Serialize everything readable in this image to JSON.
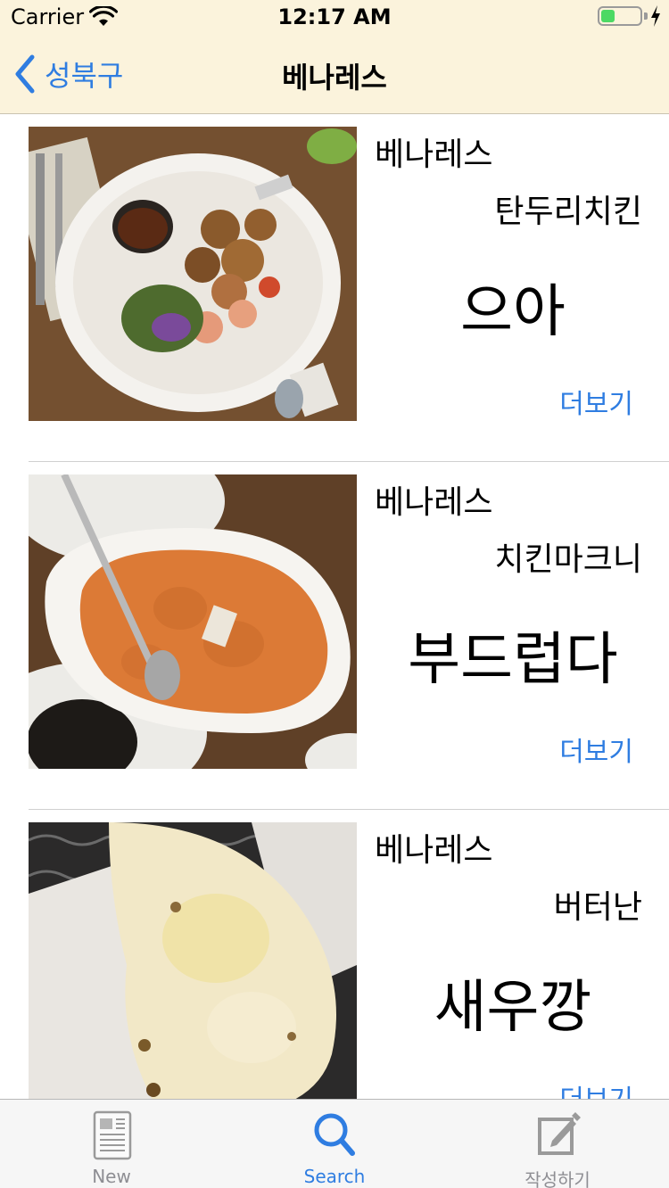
{
  "status_bar": {
    "carrier": "Carrier",
    "time": "12:17 AM",
    "battery_level": 0.35
  },
  "nav": {
    "back_label": "성북구",
    "title": "베나레스"
  },
  "reviews": [
    {
      "restaurant": "베나레스",
      "menu": "탄두리치킨",
      "review": "으아",
      "more_label": "더보기"
    },
    {
      "restaurant": "베나레스",
      "menu": "치킨마크니",
      "review": "부드럽다",
      "more_label": "더보기"
    },
    {
      "restaurant": "베나레스",
      "menu": "버터난",
      "review": "새우깡",
      "more_label": "더보기"
    }
  ],
  "tabs": [
    {
      "label": "New",
      "icon": "newspaper-icon",
      "active": false
    },
    {
      "label": "Search",
      "icon": "search-icon",
      "active": true
    },
    {
      "label": "작성하기",
      "icon": "compose-icon",
      "active": false
    }
  ],
  "colors": {
    "accent": "#2f7de1",
    "nav_background": "#fbf3dc",
    "battery": "#4cd964"
  }
}
